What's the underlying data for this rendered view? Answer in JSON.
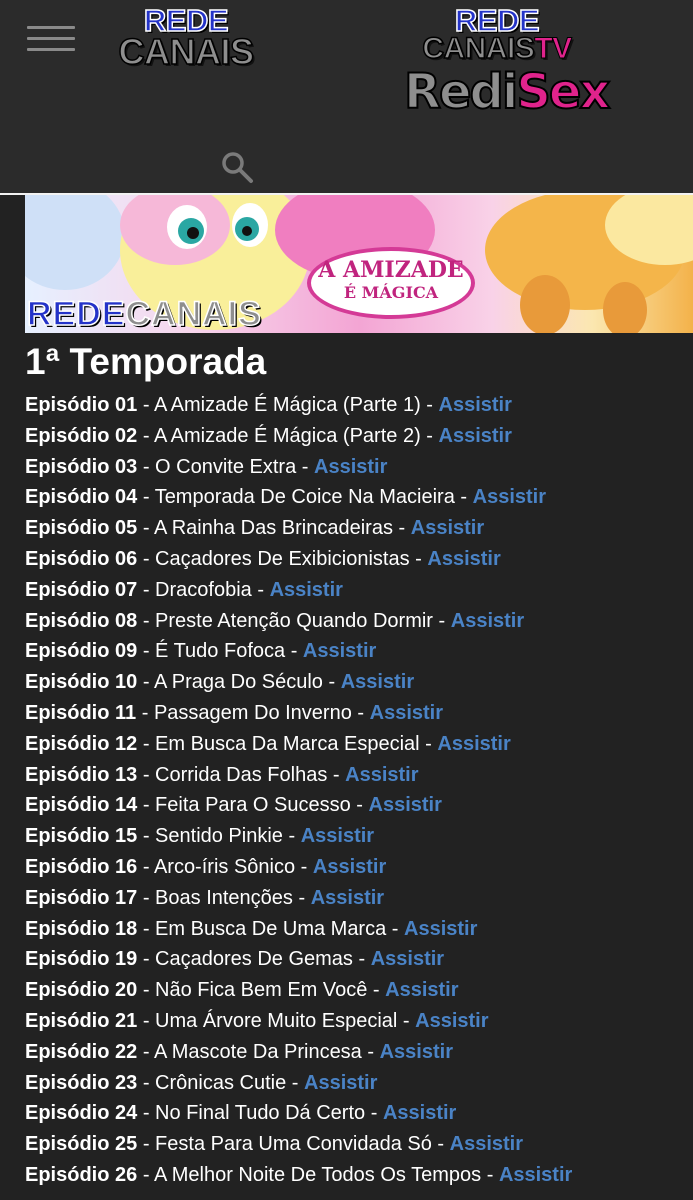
{
  "header": {
    "logo_left": {
      "line1": "REDE",
      "line2": "CANAIS"
    },
    "logo_tv": {
      "line1": "REDE",
      "line2": "CANAIS",
      "suffix": "TV"
    },
    "logo_sex": {
      "part1": "Redi",
      "part2": "Sex"
    }
  },
  "banner": {
    "brand_part1": "REDE",
    "brand_part2": "CANAIS",
    "badge_line1": "A AMIZADE",
    "badge_line2": "É MÁGICA"
  },
  "season": {
    "title": "1ª Temporada"
  },
  "link_label": "Assistir",
  "separator": "-",
  "episodes": [
    {
      "num": "Episódio 01",
      "title": "A Amizade É Mágica (Parte 1)"
    },
    {
      "num": "Episódio 02",
      "title": "A Amizade É Mágica (Parte 2)"
    },
    {
      "num": "Episódio 03",
      "title": "O Convite Extra"
    },
    {
      "num": "Episódio 04",
      "title": "Temporada De Coice Na Macieira"
    },
    {
      "num": "Episódio 05",
      "title": "A Rainha Das Brincadeiras"
    },
    {
      "num": "Episódio 06",
      "title": "Caçadores De Exibicionistas"
    },
    {
      "num": "Episódio 07",
      "title": "Dracofobia"
    },
    {
      "num": "Episódio 08",
      "title": "Preste Atenção Quando Dormir"
    },
    {
      "num": "Episódio 09",
      "title": "É Tudo Fofoca"
    },
    {
      "num": "Episódio 10",
      "title": "A Praga Do Século"
    },
    {
      "num": "Episódio 11",
      "title": "Passagem Do Inverno"
    },
    {
      "num": "Episódio 12",
      "title": "Em Busca Da Marca Especial"
    },
    {
      "num": "Episódio 13",
      "title": "Corrida Das Folhas"
    },
    {
      "num": "Episódio 14",
      "title": "Feita Para O Sucesso"
    },
    {
      "num": "Episódio 15",
      "title": "Sentido Pinkie"
    },
    {
      "num": "Episódio 16",
      "title": "Arco-íris Sônico"
    },
    {
      "num": "Episódio 17",
      "title": "Boas Intenções"
    },
    {
      "num": "Episódio 18",
      "title": "Em Busca De Uma Marca"
    },
    {
      "num": "Episódio 19",
      "title": "Caçadores De Gemas"
    },
    {
      "num": "Episódio 20",
      "title": "Não Fica Bem Em Você"
    },
    {
      "num": "Episódio 21",
      "title": "Uma Árvore Muito Especial"
    },
    {
      "num": "Episódio 22",
      "title": "A Mascote Da Princesa"
    },
    {
      "num": "Episódio 23",
      "title": "Crônicas Cutie"
    },
    {
      "num": "Episódio 24",
      "title": "No Final Tudo Dá Certo"
    },
    {
      "num": "Episódio 25",
      "title": "Festa Para Uma Convidada Só"
    },
    {
      "num": "Episódio 26",
      "title": "A Melhor Noite De Todos Os Tempos"
    }
  ],
  "colors": {
    "link": "#4a83c6",
    "background": "#222222",
    "header": "#2b2b2b"
  },
  "icons": {
    "menu": "hamburger-menu-icon",
    "search": "search-icon"
  }
}
